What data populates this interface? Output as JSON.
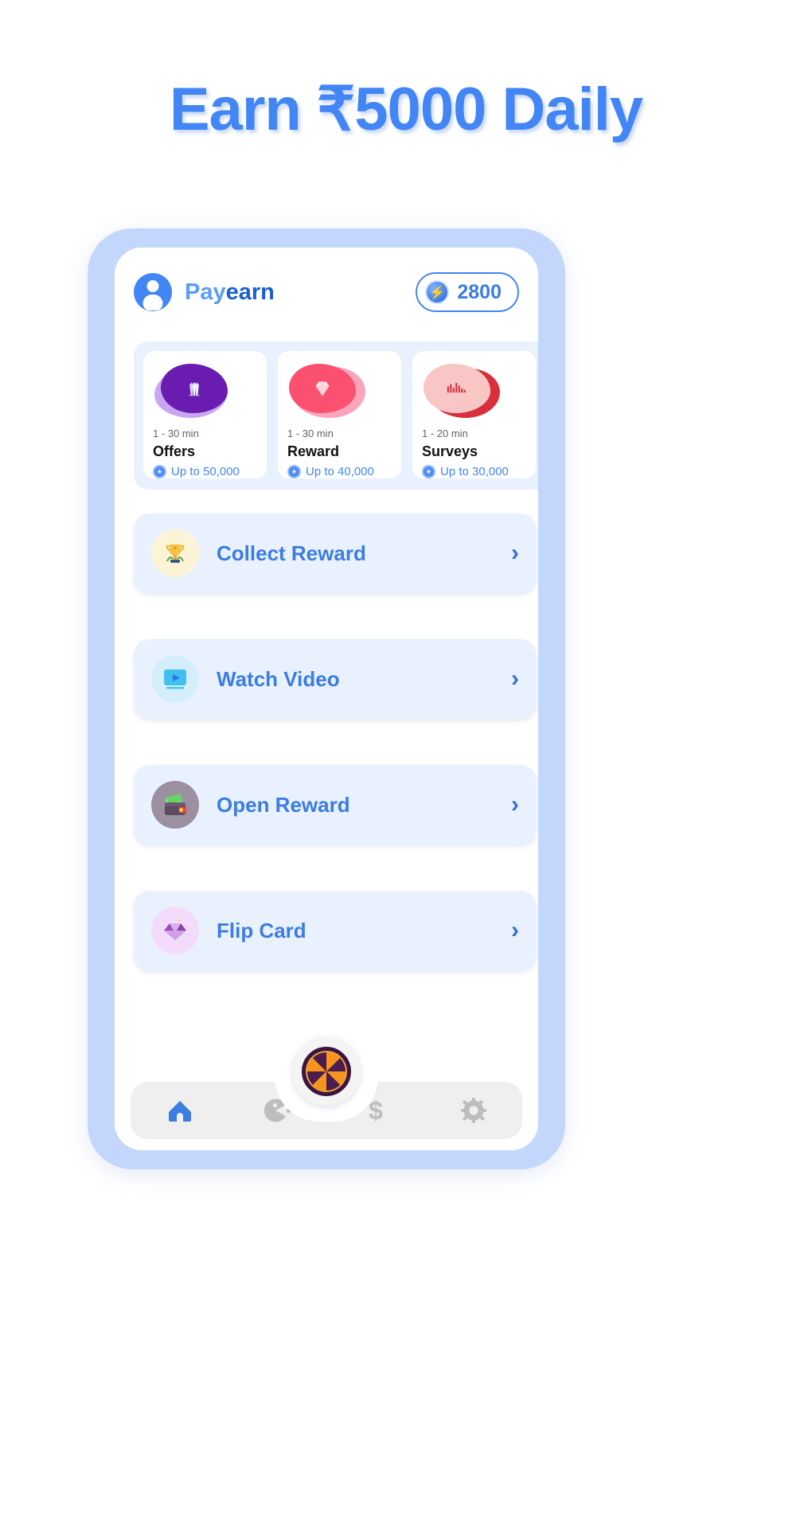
{
  "headline": "Earn ₹5000 Daily",
  "colors": {
    "accent_blue": "#4285f4",
    "brand_dark_blue": "#1a5fd0",
    "frame_blue": "#c3d7fc",
    "row_bg": "#eaf1fe",
    "nav_bg": "#efefef"
  },
  "app": {
    "brand_prefix": "Pay",
    "brand_suffix": "earn",
    "avatar_icon": "user-avatar-icon",
    "coin_badge": {
      "icon": "lightning-coin-icon",
      "glyph": "⚡",
      "amount": "2800"
    }
  },
  "categories": [
    {
      "time": "1 - 30 min",
      "name": "Offers",
      "payout": "Up to 50,000",
      "icon": "crystals-icon",
      "glyph": "💎",
      "blob_back": "#c9a6f2",
      "blob_front": "#6a1bb0"
    },
    {
      "time": "1 - 30 min",
      "name": "Reward",
      "payout": "Up to 40,000",
      "icon": "diamond-icon",
      "glyph": "💎",
      "blob_back": "#fba4bc",
      "blob_front": "#f9516f"
    },
    {
      "time": "1 - 20 min",
      "name": "Surveys",
      "payout": "Up to 30,000",
      "icon": "bar-chart-icon",
      "glyph": "📊",
      "blob_back": "#d92f3c",
      "blob_front": "#f9c6c6"
    }
  ],
  "actions": [
    {
      "label": "Collect Reward",
      "icon": "trophy-icon",
      "glyph": "🏆",
      "icon_bg": "#fdf4d8",
      "chevron": "›"
    },
    {
      "label": "Watch Video",
      "icon": "video-play-icon",
      "glyph": "📺",
      "icon_bg": "#d4effb",
      "chevron": "›"
    },
    {
      "label": "Open Reward",
      "icon": "wallet-icon",
      "glyph": "👛",
      "icon_bg": "#9b8fa0",
      "chevron": "›"
    },
    {
      "label": "Flip Card",
      "icon": "gem-icon",
      "glyph": "💎",
      "icon_bg": "#f3dcfb",
      "chevron": "›"
    }
  ],
  "bottom_nav": {
    "items": [
      {
        "icon": "home-icon",
        "active": true
      },
      {
        "icon": "game-pacman-icon",
        "active": false
      },
      {
        "icon": "dollar-icon",
        "active": false
      },
      {
        "icon": "gear-icon",
        "active": false
      }
    ],
    "center_button": {
      "icon": "spin-wheel-icon"
    }
  }
}
